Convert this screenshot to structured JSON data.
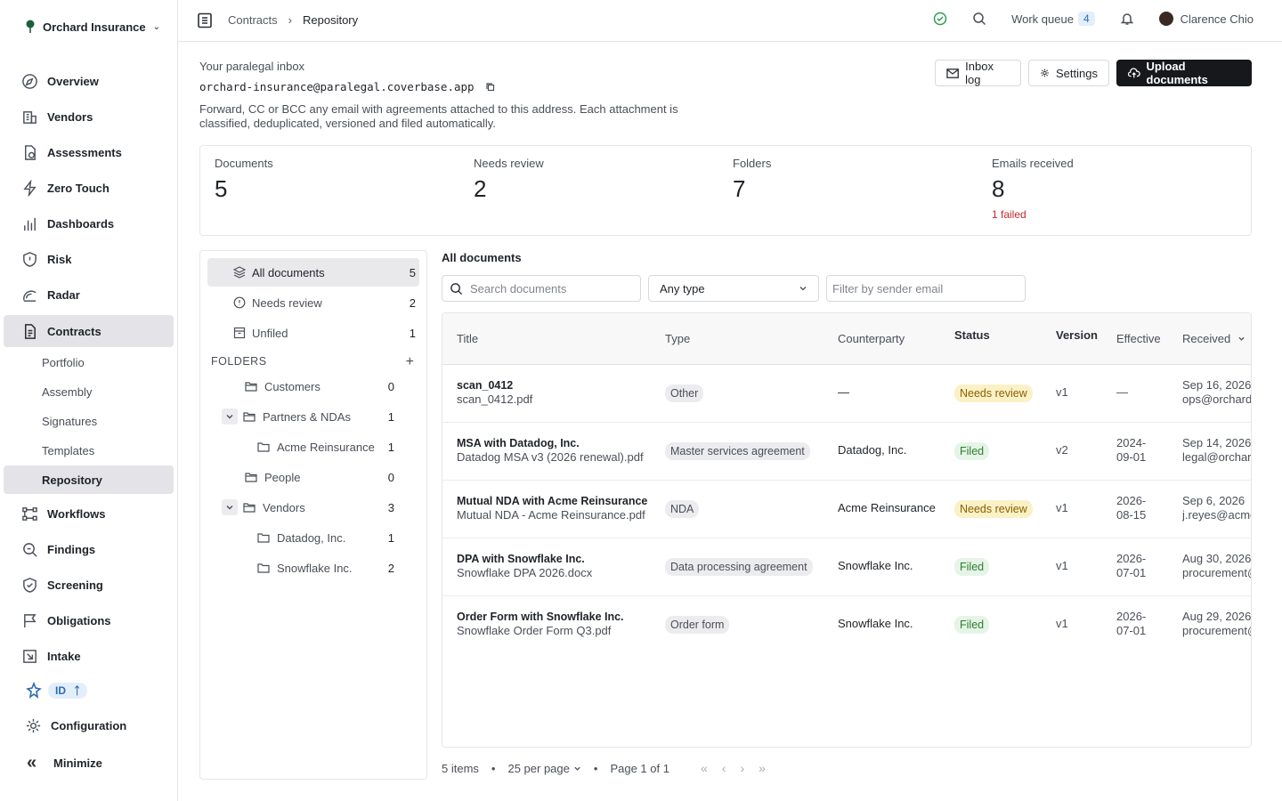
{
  "org": {
    "name": "Orchard Insurance"
  },
  "nav": {
    "items": [
      {
        "label": "Overview",
        "icon": "compass-icon"
      },
      {
        "label": "Vendors",
        "icon": "building-icon"
      },
      {
        "label": "Assessments",
        "icon": "doc-check-icon"
      },
      {
        "label": "Zero Touch",
        "icon": "bolt-icon"
      },
      {
        "label": "Dashboards",
        "icon": "bars-icon"
      },
      {
        "label": "Risk",
        "icon": "shield-icon"
      },
      {
        "label": "Radar",
        "icon": "radar-icon"
      },
      {
        "label": "Contracts",
        "icon": "contract-icon"
      },
      {
        "label": "Workflows",
        "icon": "workflow-icon"
      },
      {
        "label": "Findings",
        "icon": "findings-icon"
      },
      {
        "label": "Screening",
        "icon": "shield-check-icon"
      },
      {
        "label": "Obligations",
        "icon": "flag-icon"
      },
      {
        "label": "Intake",
        "icon": "intake-icon"
      }
    ],
    "contracts_sub": [
      "Portfolio",
      "Assembly",
      "Signatures",
      "Templates",
      "Repository"
    ],
    "id_badge": "ID",
    "configuration": "Configuration",
    "minimize": "Minimize"
  },
  "header": {
    "breadcrumb": [
      "Contracts",
      "Repository"
    ],
    "work_queue": "Work queue",
    "work_queue_count": "4",
    "user": "Clarence Chio"
  },
  "inbox": {
    "label": "Your paralegal inbox",
    "email": "orchard-insurance@paralegal.coverbase.app",
    "description": "Forward, CC or BCC any email with agreements attached to this address. Each attachment is classified, deduplicated, versioned and filed automatically.",
    "buttons": {
      "inbox_log": "Inbox log",
      "settings": "Settings",
      "upload": "Upload documents"
    }
  },
  "stats": [
    {
      "label": "Documents",
      "value": "5"
    },
    {
      "label": "Needs review",
      "value": "2"
    },
    {
      "label": "Folders",
      "value": "7"
    },
    {
      "label": "Emails received",
      "value": "8",
      "note": "1 failed"
    }
  ],
  "folders": {
    "all": {
      "label": "All documents",
      "count": "5"
    },
    "review": {
      "label": "Needs review",
      "count": "2"
    },
    "unfiled": {
      "label": "Unfiled",
      "count": "1"
    },
    "header": "FOLDERS",
    "tree": [
      {
        "label": "Customers",
        "count": "0"
      },
      {
        "label": "Partners & NDAs",
        "count": "1"
      },
      {
        "label": "Acme Reinsurance",
        "count": "1"
      },
      {
        "label": "People",
        "count": "0"
      },
      {
        "label": "Vendors",
        "count": "3"
      },
      {
        "label": "Datadog, Inc.",
        "count": "1"
      },
      {
        "label": "Snowflake Inc.",
        "count": "2"
      }
    ]
  },
  "docs": {
    "title": "All documents",
    "search_placeholder": "Search documents",
    "type_select": "Any type",
    "sender_placeholder": "Filter by sender email",
    "columns": [
      "Title",
      "Type",
      "Counterparty",
      "Status",
      "Version",
      "Effective",
      "Received"
    ],
    "rows": [
      {
        "title": "scan_0412",
        "file": "scan_0412.pdf",
        "type": "Other",
        "counterparty": "—",
        "status": "Needs review",
        "version": "v1",
        "eff1": "—",
        "eff2": "",
        "received": "Sep 16, 2026",
        "sender": "ops@orchard"
      },
      {
        "title": "MSA with Datadog, Inc.",
        "file": "Datadog MSA v3 (2026 renewal).pdf",
        "type": "Master services agreement",
        "counterparty": "Datadog, Inc.",
        "status": "Filed",
        "version": "v2",
        "eff1": "2024-",
        "eff2": "09-01",
        "received": "Sep 14, 2026",
        "sender": "legal@orchar"
      },
      {
        "title": "Mutual NDA with Acme Reinsurance",
        "file": "Mutual NDA - Acme Reinsurance.pdf",
        "type": "NDA",
        "counterparty": "Acme Reinsurance",
        "status": "Needs review",
        "version": "v1",
        "eff1": "2026-",
        "eff2": "08-15",
        "received": "Sep 6, 2026",
        "sender": "j.reyes@acme"
      },
      {
        "title": "DPA with Snowflake Inc.",
        "file": "Snowflake DPA 2026.docx",
        "type": "Data processing agreement",
        "counterparty": "Snowflake Inc.",
        "status": "Filed",
        "version": "v1",
        "eff1": "2026-",
        "eff2": "07-01",
        "received": "Aug 30, 2026",
        "sender": "procurement@"
      },
      {
        "title": "Order Form with Snowflake Inc.",
        "file": "Snowflake Order Form Q3.pdf",
        "type": "Order form",
        "counterparty": "Snowflake Inc.",
        "status": "Filed",
        "version": "v1",
        "eff1": "2026-",
        "eff2": "07-01",
        "received": "Aug 29, 2026",
        "sender": "procurement@"
      }
    ]
  },
  "pager": {
    "items": "5 items",
    "per_page": "25 per page",
    "page": "Page 1 of 1"
  }
}
